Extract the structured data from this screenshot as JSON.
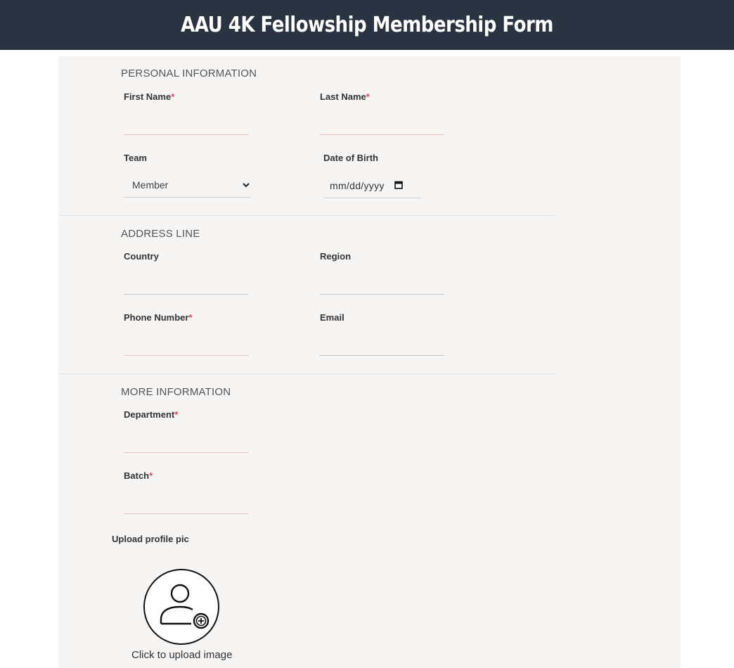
{
  "header": {
    "title": "AAU 4K Fellowship Membership Form"
  },
  "sections": {
    "personal": {
      "title": "PERSONAL INFORMATION",
      "first_name": {
        "label": "First Name",
        "required_mark": "*",
        "value": ""
      },
      "last_name": {
        "label": "Last Name",
        "required_mark": "*",
        "value": ""
      },
      "team": {
        "label": "Team",
        "selected": "Member"
      },
      "dob": {
        "label": "Date of Birth",
        "placeholder": "mm/dd/yyyy"
      }
    },
    "address": {
      "title": "ADDRESS LINE",
      "country": {
        "label": "Country",
        "value": ""
      },
      "region": {
        "label": "Region",
        "value": ""
      },
      "phone": {
        "label": "Phone Number",
        "required_mark": "*",
        "value": ""
      },
      "email": {
        "label": "Email",
        "value": ""
      }
    },
    "more": {
      "title": "MORE INFORMATION",
      "department": {
        "label": "Department",
        "required_mark": "*",
        "value": ""
      },
      "batch": {
        "label": "Batch",
        "required_mark": "*",
        "value": ""
      }
    }
  },
  "upload": {
    "label": "Upload profile pic",
    "hint": "Click to upload image",
    "icon": "user-add-icon"
  },
  "colors": {
    "header_bg": "#2a3342",
    "card_bg": "#f6f5f4",
    "required": "#e0455a"
  }
}
